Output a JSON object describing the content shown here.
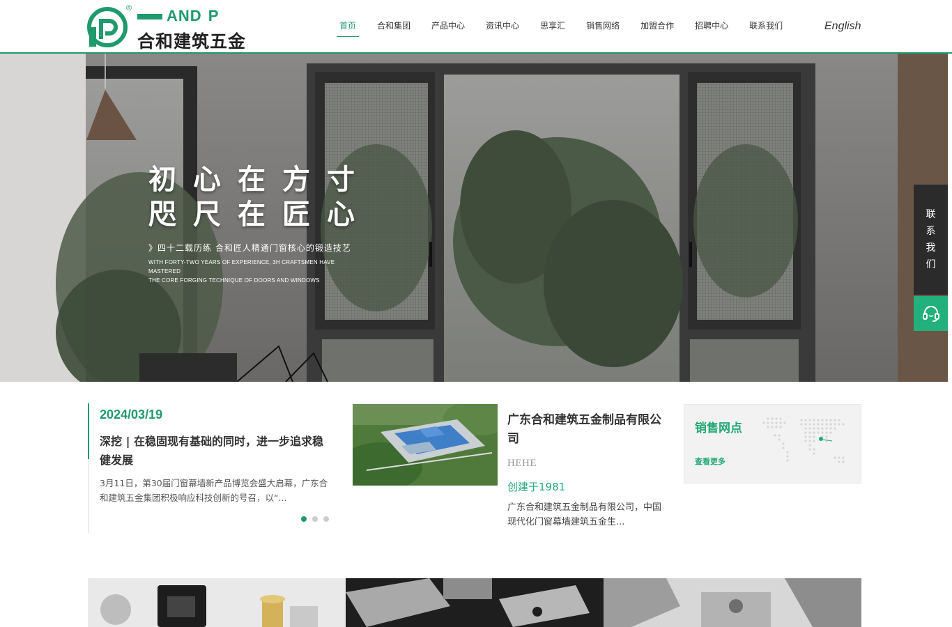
{
  "header": {
    "logo": {
      "brand_en_letters": "AND",
      "brand_en_lead": "H",
      "brand_en_tail": "P",
      "registered": "®",
      "brand_cn": "合和建筑五金",
      "logo_color": "#1f9a6c"
    },
    "nav": [
      {
        "label": "首页",
        "active": true
      },
      {
        "label": "合和集团",
        "active": false
      },
      {
        "label": "产品中心",
        "active": false
      },
      {
        "label": "资讯中心",
        "active": false
      },
      {
        "label": "思享汇",
        "active": false
      },
      {
        "label": "销售网络",
        "active": false
      },
      {
        "label": "加盟合作",
        "active": false
      },
      {
        "label": "招聘中心",
        "active": false
      },
      {
        "label": "联系我们",
        "active": false
      }
    ],
    "language": "English"
  },
  "hero": {
    "headline_1": "初心在方寸",
    "headline_2": "咫尺在匠心",
    "subtitle": "》四十二载历练 合和匠人精通门窗核心的锻造技艺",
    "subtitle_en_1": "WITH FORTY-TWO YEARS OF EXPERIENCE, 3H CRAFTSMEN HAVE MASTERED",
    "subtitle_en_2": "THE CORE FORGING TECHNIQUE OF DOORS AND WINDOWS"
  },
  "side_float": {
    "contact_chars": [
      "联",
      "系",
      "我",
      "们"
    ],
    "service_icon": "headset-icon"
  },
  "news": {
    "date": "2024/03/19",
    "title": "深挖 | 在稳固现有基础的同时，进一步追求稳健发展",
    "body": "3月11日，第30届门窗幕墙新产品博览会盛大启幕，广东合和建筑五金集团积极响应科技创新的号召，以“...",
    "dots": [
      true,
      false,
      false
    ]
  },
  "company": {
    "name": "广东合和建筑五金制品有限公司",
    "name_en": "HEHE",
    "founded": "创建于1981",
    "description": "广东合和建筑五金制品有限公司，中国现代化门窗幕墙建筑五金生..."
  },
  "sales": {
    "title": "销售网点",
    "more": "查看更多"
  },
  "colors": {
    "brand_green": "#1f9a6c",
    "accent_green": "#22a876",
    "dark": "#2b2b2b"
  }
}
